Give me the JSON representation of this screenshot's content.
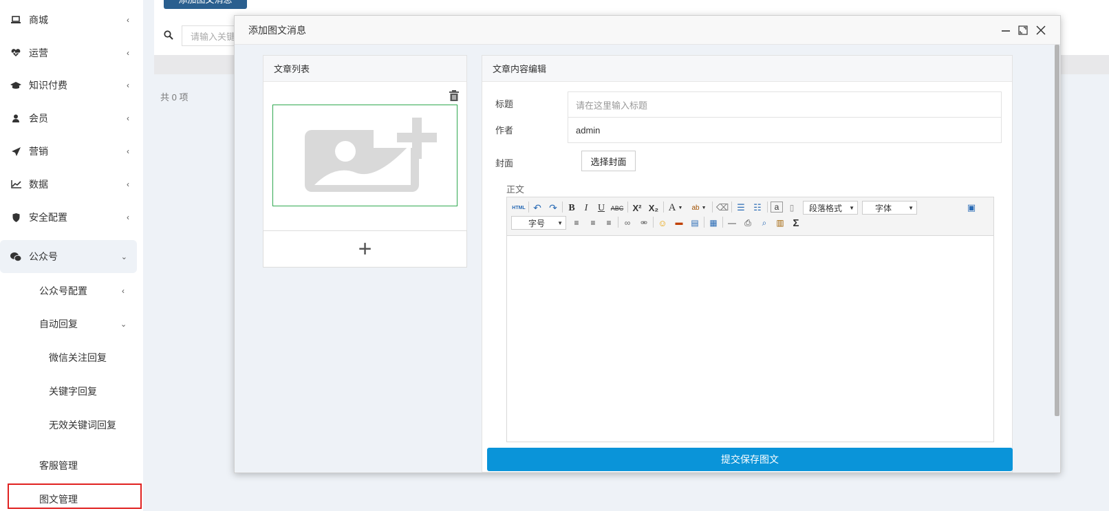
{
  "sidebar": {
    "items": [
      {
        "label": "商城",
        "icon": "laptop-icon"
      },
      {
        "label": "运营",
        "icon": "heartbeat-icon"
      },
      {
        "label": "知识付费",
        "icon": "graduation-cap-icon"
      },
      {
        "label": "会员",
        "icon": "user-icon"
      },
      {
        "label": "营销",
        "icon": "paper-plane-icon"
      },
      {
        "label": "数据",
        "icon": "line-chart-icon"
      },
      {
        "label": "安全配置",
        "icon": "shield-icon"
      },
      {
        "label": "公众号",
        "icon": "wechat-icon"
      }
    ],
    "sub": {
      "config": "公众号配置",
      "auto_reply": "自动回复",
      "follow_reply": "微信关注回复",
      "keyword_reply": "关键字回复",
      "invalid_keyword_reply": "无效关键词回复",
      "service": "客服管理",
      "news_manage": "图文管理"
    }
  },
  "background": {
    "add_button": "添加图文消息",
    "search_placeholder": "请输入关键",
    "count_text": "共 0 项"
  },
  "modal": {
    "title": "添加图文消息",
    "list_panel_title": "文章列表",
    "editor_panel_title": "文章内容编辑",
    "plus_label": "+",
    "form": {
      "title_label": "标题",
      "title_placeholder": "请在这里输入标题",
      "author_label": "作者",
      "author_value": "admin",
      "cover_label": "封面",
      "cover_button": "选择封面",
      "body_label": "正文"
    },
    "toolbar": {
      "paragraph": "段落格式",
      "font": "字体",
      "size": "字号"
    },
    "submit": "提交保存图文"
  },
  "colors": {
    "submit": "#0a94d9",
    "highlight": "#e0201f",
    "cover_border": "#2fa84f"
  }
}
